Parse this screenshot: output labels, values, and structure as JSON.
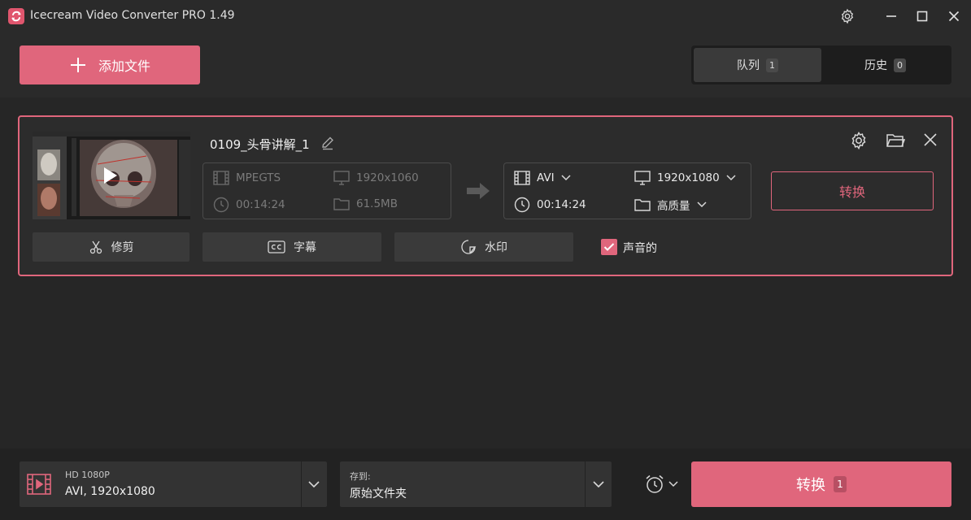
{
  "window": {
    "title": "Icecream Video Converter PRO 1.49",
    "controls": [
      "settings-icon",
      "minimize-icon",
      "maximize-icon",
      "close-icon"
    ]
  },
  "toolbar": {
    "add_file_label": "添加文件",
    "tabs": [
      {
        "label": "队列",
        "count": "1",
        "active": true
      },
      {
        "label": "历史",
        "count": "0",
        "active": false
      }
    ]
  },
  "file_item": {
    "name": "0109_头骨讲解_1",
    "source": {
      "format": "MPEGTS",
      "resolution": "1920x1060",
      "duration": "00:14:24",
      "size": "61.5MB"
    },
    "target": {
      "format": "AVI",
      "resolution": "1920x1080",
      "duration": "00:14:24",
      "quality": "高质量"
    },
    "convert_label": "转换",
    "actions": {
      "trim": "修剪",
      "subtitles": "字幕",
      "watermark": "水印",
      "sound": "声音的",
      "sound_checked": true
    }
  },
  "bottom": {
    "format_preset_top": "HD 1080P",
    "format_preset_main": "AVI, 1920x1080",
    "save_to_label": "存到:",
    "save_to_value": "原始文件夹",
    "convert_all_label": "转换",
    "convert_all_count": "1"
  },
  "colors": {
    "accent": "#e0667c",
    "background": "#2a2a2a",
    "panel": "#333333"
  }
}
